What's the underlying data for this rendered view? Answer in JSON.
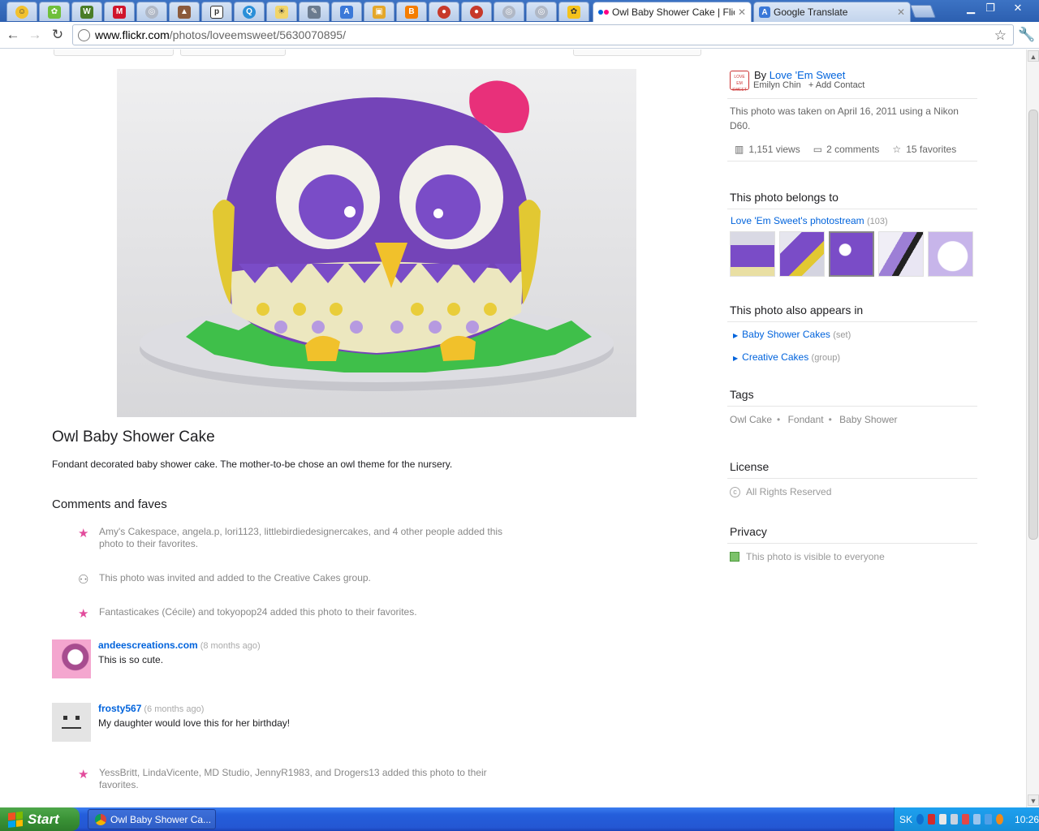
{
  "browser": {
    "tabs": [
      {
        "title": "Owl Baby Shower Cake | Flickr",
        "active": true
      },
      {
        "title": "Google Translate",
        "active": false
      }
    ],
    "url_host": "www.flickr.com",
    "url_path": "/photos/loveemsweet/5630070895/"
  },
  "photo": {
    "title": "Owl Baby Shower Cake",
    "description": "Fondant decorated baby shower cake. The mother-to-be chose an owl theme for the nursery."
  },
  "comments_section": {
    "heading": "Comments and faves",
    "activity": [
      {
        "text": "Amy's Cakespace, angela.p, lori1123, littlebirdiedesignercakes, and 4 other people added this photo to their favorites.",
        "icon": "star-icon"
      },
      {
        "text": "This photo was invited and added to the Creative Cakes group.",
        "icon": "group-icon"
      },
      {
        "text": "Fantasticakes (Cécile) and tokyopop24 added this photo to their favorites.",
        "icon": "star-icon"
      },
      {
        "text": "YessBritt, LindaVicente, MD Studio, JennyR1983, and Drogers13 added this photo to their favorites.",
        "icon": "star-icon"
      }
    ],
    "comments": [
      {
        "author": "andeescreations.com",
        "when": "(8 months ago)",
        "text": "This is so cute."
      },
      {
        "author": "frosty567",
        "when": "(6 months ago)",
        "text": "My daughter would love this for her birthday!"
      }
    ]
  },
  "sidebar": {
    "by_label": "By",
    "owner": "Love 'Em Sweet",
    "owner_realname": "Emilyn Chin",
    "add_contact": "+ Add Contact",
    "taken": "This photo was taken on April 16, 2011 using a Nikon D60.",
    "views": "1,151 views",
    "comments": "2 comments",
    "favorites": "15 favorites",
    "belongs_heading": "This photo belongs to",
    "stream_name": "Love 'Em Sweet's photostream",
    "stream_count": "(103)",
    "appears_heading": "This photo also appears in",
    "appears": [
      {
        "name": "Baby Shower Cakes",
        "kind": "(set)"
      },
      {
        "name": "Creative Cakes",
        "kind": "(group)"
      }
    ],
    "tags_heading": "Tags",
    "tags": [
      "Owl Cake",
      "Fondant",
      "Baby Shower"
    ],
    "license_heading": "License",
    "license": "All Rights Reserved",
    "privacy_heading": "Privacy",
    "privacy": "This photo is visible to everyone"
  },
  "taskbar": {
    "start": "Start",
    "task": "Owl Baby Shower Ca...",
    "lang": "SK",
    "clock": "10:26"
  },
  "colors": {
    "link": "#0063dc",
    "fave_star": "#e24c9c",
    "taskbar": "#245edb"
  }
}
